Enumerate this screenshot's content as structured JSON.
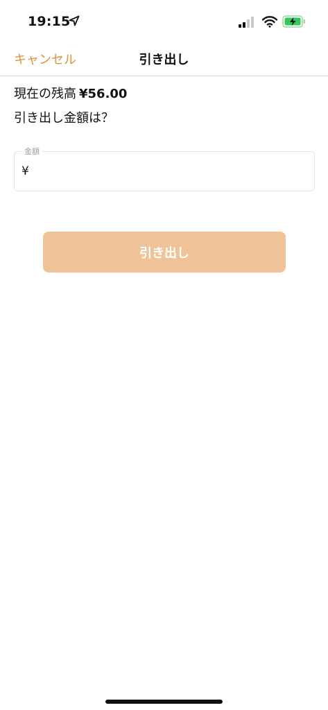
{
  "status_bar": {
    "time": "19:15"
  },
  "nav": {
    "cancel_label": "キャンセル",
    "title": "引き出し"
  },
  "balance": {
    "label": "現在の残高",
    "value": "¥56.00"
  },
  "question": "引き出し金額は？",
  "amount_field": {
    "legend": "金額",
    "currency": "¥",
    "value": ""
  },
  "withdraw_button": {
    "label": "引き出し"
  },
  "colors": {
    "accent": "#e0913c",
    "button_disabled": "#f0c297",
    "battery_fill": "#34c759"
  },
  "icons": [
    "location-arrow-icon",
    "cellular-signal-icon",
    "wifi-icon",
    "battery-charging-icon"
  ]
}
